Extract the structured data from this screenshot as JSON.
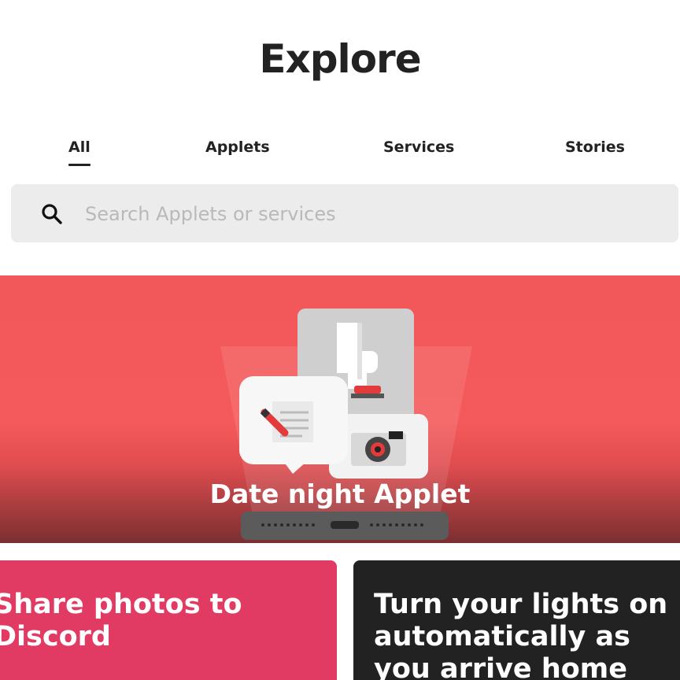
{
  "header": {
    "title": "Explore"
  },
  "tabs": [
    {
      "label": "All",
      "active": true
    },
    {
      "label": "Applets",
      "active": false
    },
    {
      "label": "Services",
      "active": false
    },
    {
      "label": "Stories",
      "active": false
    }
  ],
  "search": {
    "placeholder": "Search Applets or services",
    "icon": "search-icon"
  },
  "hero": {
    "title": "Date night Applet",
    "color": "#f45a5b"
  },
  "cards": [
    {
      "title": "Share photos to Discord",
      "color": "#e13b63"
    },
    {
      "title": "Turn your lights on automatically as you arrive home",
      "color": "#222222"
    }
  ]
}
